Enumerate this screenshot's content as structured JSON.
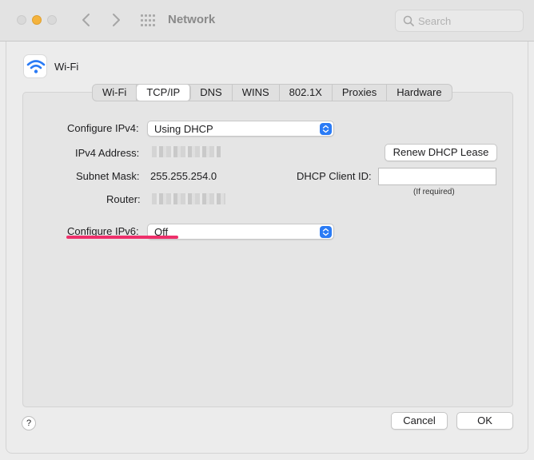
{
  "toolbar": {
    "title": "Network",
    "search_placeholder": "Search",
    "icons": [
      "chevron-left-icon",
      "chevron-right-icon",
      "grid-icon",
      "search-icon"
    ]
  },
  "service": {
    "name": "Wi-Fi",
    "icon": "wifi-icon",
    "icon_color": "#2a7bf5"
  },
  "tabs": [
    {
      "label": "Wi-Fi",
      "active": false
    },
    {
      "label": "TCP/IP",
      "active": true
    },
    {
      "label": "DNS",
      "active": false
    },
    {
      "label": "WINS",
      "active": false
    },
    {
      "label": "802.1X",
      "active": false
    },
    {
      "label": "Proxies",
      "active": false
    },
    {
      "label": "Hardware",
      "active": false
    }
  ],
  "form": {
    "configure_ipv4_label": "Configure IPv4:",
    "configure_ipv4_value": "Using DHCP",
    "ipv4_address_label": "IPv4 Address:",
    "subnet_mask_label": "Subnet Mask:",
    "subnet_mask_value": "255.255.254.0",
    "router_label": "Router:",
    "renew_button": "Renew DHCP Lease",
    "dhcp_client_id_label": "DHCP Client ID:",
    "dhcp_client_id_value": "",
    "dhcp_hint": "(If required)",
    "configure_ipv6_label": "Configure IPv6:",
    "configure_ipv6_value": "Off"
  },
  "footer": {
    "help_label": "?",
    "cancel_label": "Cancel",
    "ok_label": "OK"
  },
  "colors": {
    "accent": "#2a7bf5",
    "annotation": "#ee2f6a",
    "minimize": "#f4b33d"
  }
}
